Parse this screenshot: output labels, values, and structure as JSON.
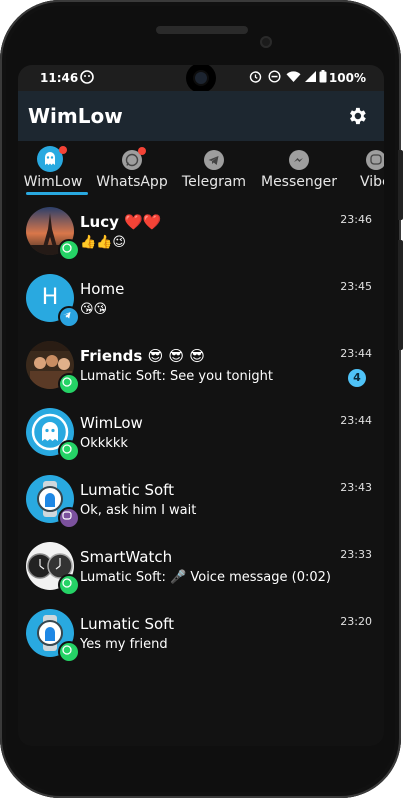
{
  "status_bar": {
    "time": "11:46",
    "battery": "100%"
  },
  "app_bar": {
    "title": "WimLow",
    "settings_icon": "gear-icon"
  },
  "tabs": [
    {
      "label": "WimLow",
      "icon": "wimlow-ghost-icon",
      "has_dot": true,
      "selected": true
    },
    {
      "label": "WhatsApp",
      "icon": "whatsapp-icon",
      "has_dot": true,
      "selected": false
    },
    {
      "label": "Telegram",
      "icon": "telegram-icon",
      "has_dot": false,
      "selected": false
    },
    {
      "label": "Messenger",
      "icon": "messenger-icon",
      "has_dot": false,
      "selected": false
    },
    {
      "label": "Vibe",
      "icon": "viber-icon",
      "has_dot": false,
      "selected": false
    }
  ],
  "colors": {
    "accent": "#29a9e0",
    "app_bar": "#1d2730",
    "background": "#121212",
    "whatsapp": "#25d366",
    "telegram": "#2aa3e0",
    "viber": "#7b519d",
    "unread_badge": "#4fc3f7"
  },
  "chats": [
    {
      "name": "Lucy ❤️❤️",
      "bold": true,
      "message": "👍👍😉",
      "time": "23:46",
      "app": "whatsapp",
      "avatar": "eiffel-photo",
      "unread": ""
    },
    {
      "name": "Home",
      "bold": false,
      "message": "😘😘",
      "time": "23:45",
      "app": "telegram",
      "avatar": "letter",
      "avatar_letter": "H",
      "unread": ""
    },
    {
      "name": "Friends 😎 😎 😎",
      "bold": true,
      "message": "Lumatic Soft: See you tonight",
      "time": "23:44",
      "app": "whatsapp",
      "avatar": "group-photo",
      "unread": "4"
    },
    {
      "name": "WimLow",
      "bold": false,
      "message": "Okkkkk",
      "time": "23:44",
      "app": "whatsapp",
      "avatar": "ghost",
      "unread": ""
    },
    {
      "name": "Lumatic Soft",
      "bold": false,
      "message": "Ok, ask him I wait",
      "time": "23:43",
      "app": "viber",
      "avatar": "android-watch",
      "unread": ""
    },
    {
      "name": "SmartWatch",
      "bold": false,
      "message": "Lumatic Soft: 🎤 Voice message (0:02)",
      "time": "23:33",
      "app": "whatsapp",
      "avatar": "watch-faces",
      "unread": ""
    },
    {
      "name": "Lumatic Soft",
      "bold": false,
      "message": "Yes my friend",
      "time": "23:20",
      "app": "whatsapp",
      "avatar": "android-watch",
      "unread": ""
    }
  ]
}
